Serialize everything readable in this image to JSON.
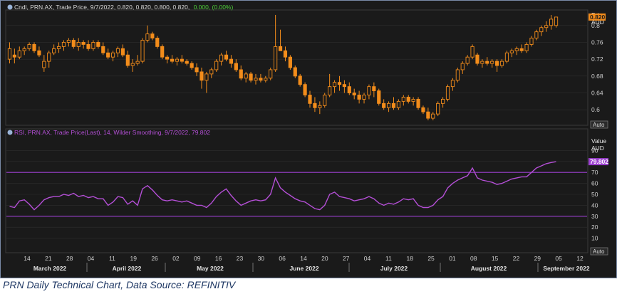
{
  "caption": "PRN Daily Technical Chart, Data Source: REFINITIV",
  "colors": {
    "background": "#1a1a1a",
    "candle": "#f28c1b",
    "rsi_line": "#b44fd6",
    "rsi_band": "#9c3fd0",
    "grid": "#2e2e2e",
    "axis_text": "#cfcfcf",
    "price_header_text": "#d8d8d8",
    "change_text": "#4fd13a"
  },
  "price_panel": {
    "header_parts": {
      "name": "Cndl, PRN.AX, Trade Price, 9/7/2022, 0.820, 0.820, 0.800, 0.820,",
      "change": "0.000, (0.00%)"
    },
    "axis_title": "Price",
    "axis_unit": "AUD",
    "last_value_tag": "0.820",
    "scale_button": "Auto",
    "ticks": [
      "0.8",
      "0.76",
      "0.72",
      "0.68",
      "0.64",
      "0.6"
    ]
  },
  "rsi_panel": {
    "header": "RSI, PRN.AX, Trade Price(Last), 14, Wilder Smoothing, 9/7/2022, 79.802",
    "axis_title": "Value",
    "axis_unit": "AUD",
    "last_value_tag": "79.802",
    "scale_button": "Auto",
    "ticks": [
      "90",
      "80",
      "70",
      "60",
      "50",
      "40",
      "30",
      "20",
      "10"
    ]
  },
  "x_axis": {
    "day_labels": [
      "14",
      "21",
      "28",
      "04",
      "11",
      "19",
      "26",
      "02",
      "09",
      "16",
      "23",
      "30",
      "06",
      "14",
      "20",
      "27",
      "04",
      "11",
      "18",
      "25",
      "01",
      "08",
      "15",
      "22",
      "29",
      "05",
      "12"
    ],
    "month_labels": [
      "March 2022",
      "April 2022",
      "May 2022",
      "June 2022",
      "July 2022",
      "August 2022",
      "September 2022"
    ]
  },
  "chart_data": [
    {
      "type": "candlestick",
      "ylabel": "Price AUD",
      "ylim": [
        0.57,
        0.83
      ],
      "ohlc": [
        [
          0.72,
          0.76,
          0.71,
          0.745
        ],
        [
          0.73,
          0.745,
          0.71,
          0.725
        ],
        [
          0.725,
          0.75,
          0.72,
          0.74
        ],
        [
          0.74,
          0.75,
          0.73,
          0.745
        ],
        [
          0.745,
          0.76,
          0.74,
          0.755
        ],
        [
          0.755,
          0.76,
          0.735,
          0.74
        ],
        [
          0.74,
          0.75,
          0.725,
          0.73
        ],
        [
          0.7,
          0.73,
          0.69,
          0.715
        ],
        [
          0.715,
          0.74,
          0.7,
          0.735
        ],
        [
          0.735,
          0.755,
          0.73,
          0.745
        ],
        [
          0.745,
          0.76,
          0.735,
          0.75
        ],
        [
          0.75,
          0.765,
          0.74,
          0.76
        ],
        [
          0.76,
          0.77,
          0.75,
          0.765
        ],
        [
          0.765,
          0.77,
          0.745,
          0.75
        ],
        [
          0.75,
          0.77,
          0.74,
          0.76
        ],
        [
          0.76,
          0.765,
          0.745,
          0.755
        ],
        [
          0.755,
          0.765,
          0.74,
          0.745
        ],
        [
          0.745,
          0.765,
          0.74,
          0.76
        ],
        [
          0.76,
          0.765,
          0.745,
          0.75
        ],
        [
          0.75,
          0.76,
          0.73,
          0.735
        ],
        [
          0.735,
          0.745,
          0.72,
          0.725
        ],
        [
          0.725,
          0.74,
          0.715,
          0.735
        ],
        [
          0.735,
          0.75,
          0.725,
          0.745
        ],
        [
          0.745,
          0.755,
          0.725,
          0.73
        ],
        [
          0.73,
          0.74,
          0.7,
          0.705
        ],
        [
          0.705,
          0.72,
          0.69,
          0.71
        ],
        [
          0.71,
          0.73,
          0.705,
          0.715
        ],
        [
          0.715,
          0.77,
          0.71,
          0.765
        ],
        [
          0.765,
          0.8,
          0.76,
          0.78
        ],
        [
          0.78,
          0.785,
          0.765,
          0.77
        ],
        [
          0.77,
          0.775,
          0.745,
          0.75
        ],
        [
          0.75,
          0.755,
          0.72,
          0.725
        ],
        [
          0.725,
          0.73,
          0.71,
          0.72
        ],
        [
          0.72,
          0.73,
          0.71,
          0.715
        ],
        [
          0.715,
          0.725,
          0.705,
          0.72
        ],
        [
          0.72,
          0.73,
          0.71,
          0.715
        ],
        [
          0.715,
          0.72,
          0.705,
          0.71
        ],
        [
          0.71,
          0.715,
          0.695,
          0.7
        ],
        [
          0.7,
          0.71,
          0.68,
          0.69
        ],
        [
          0.69,
          0.7,
          0.65,
          0.67
        ],
        [
          0.67,
          0.69,
          0.64,
          0.685
        ],
        [
          0.685,
          0.7,
          0.675,
          0.695
        ],
        [
          0.695,
          0.72,
          0.69,
          0.715
        ],
        [
          0.715,
          0.735,
          0.705,
          0.73
        ],
        [
          0.73,
          0.74,
          0.715,
          0.72
        ],
        [
          0.72,
          0.73,
          0.7,
          0.71
        ],
        [
          0.71,
          0.72,
          0.69,
          0.695
        ],
        [
          0.695,
          0.705,
          0.67,
          0.675
        ],
        [
          0.675,
          0.69,
          0.665,
          0.685
        ],
        [
          0.685,
          0.69,
          0.665,
          0.67
        ],
        [
          0.67,
          0.685,
          0.66,
          0.675
        ],
        [
          0.675,
          0.685,
          0.665,
          0.67
        ],
        [
          0.67,
          0.68,
          0.665,
          0.675
        ],
        [
          0.675,
          0.7,
          0.67,
          0.695
        ],
        [
          0.695,
          0.825,
          0.69,
          0.75
        ],
        [
          0.75,
          0.79,
          0.74,
          0.74
        ],
        [
          0.74,
          0.75,
          0.715,
          0.725
        ],
        [
          0.725,
          0.73,
          0.695,
          0.7
        ],
        [
          0.7,
          0.705,
          0.675,
          0.68
        ],
        [
          0.68,
          0.685,
          0.655,
          0.66
        ],
        [
          0.66,
          0.665,
          0.63,
          0.635
        ],
        [
          0.635,
          0.645,
          0.605,
          0.615
        ],
        [
          0.615,
          0.63,
          0.595,
          0.605
        ],
        [
          0.605,
          0.62,
          0.59,
          0.61
        ],
        [
          0.61,
          0.64,
          0.605,
          0.635
        ],
        [
          0.635,
          0.685,
          0.63,
          0.655
        ],
        [
          0.655,
          0.67,
          0.64,
          0.665
        ],
        [
          0.665,
          0.68,
          0.645,
          0.66
        ],
        [
          0.66,
          0.67,
          0.64,
          0.655
        ],
        [
          0.655,
          0.665,
          0.635,
          0.64
        ],
        [
          0.64,
          0.65,
          0.625,
          0.635
        ],
        [
          0.635,
          0.645,
          0.615,
          0.625
        ],
        [
          0.625,
          0.64,
          0.615,
          0.635
        ],
        [
          0.635,
          0.66,
          0.625,
          0.655
        ],
        [
          0.655,
          0.665,
          0.63,
          0.645
        ],
        [
          0.645,
          0.65,
          0.61,
          0.615
        ],
        [
          0.615,
          0.625,
          0.6,
          0.605
        ],
        [
          0.605,
          0.62,
          0.595,
          0.615
        ],
        [
          0.615,
          0.63,
          0.6,
          0.605
        ],
        [
          0.605,
          0.625,
          0.6,
          0.62
        ],
        [
          0.62,
          0.635,
          0.61,
          0.63
        ],
        [
          0.63,
          0.635,
          0.615,
          0.62
        ],
        [
          0.62,
          0.63,
          0.61,
          0.625
        ],
        [
          0.625,
          0.63,
          0.6,
          0.605
        ],
        [
          0.605,
          0.61,
          0.59,
          0.595
        ],
        [
          0.595,
          0.605,
          0.575,
          0.58
        ],
        [
          0.58,
          0.595,
          0.575,
          0.59
        ],
        [
          0.59,
          0.62,
          0.585,
          0.615
        ],
        [
          0.615,
          0.63,
          0.605,
          0.625
        ],
        [
          0.625,
          0.66,
          0.62,
          0.655
        ],
        [
          0.655,
          0.675,
          0.645,
          0.67
        ],
        [
          0.67,
          0.7,
          0.665,
          0.695
        ],
        [
          0.695,
          0.715,
          0.685,
          0.71
        ],
        [
          0.71,
          0.73,
          0.705,
          0.725
        ],
        [
          0.725,
          0.755,
          0.72,
          0.75
        ],
        [
          0.73,
          0.735,
          0.705,
          0.71
        ],
        [
          0.71,
          0.72,
          0.7,
          0.715
        ],
        [
          0.715,
          0.725,
          0.705,
          0.71
        ],
        [
          0.71,
          0.72,
          0.7,
          0.715
        ],
        [
          0.715,
          0.72,
          0.69,
          0.705
        ],
        [
          0.705,
          0.72,
          0.7,
          0.715
        ],
        [
          0.715,
          0.74,
          0.71,
          0.735
        ],
        [
          0.735,
          0.745,
          0.725,
          0.74
        ],
        [
          0.74,
          0.75,
          0.73,
          0.745
        ],
        [
          0.745,
          0.755,
          0.735,
          0.74
        ],
        [
          0.74,
          0.76,
          0.735,
          0.755
        ],
        [
          0.755,
          0.775,
          0.75,
          0.77
        ],
        [
          0.77,
          0.79,
          0.765,
          0.785
        ],
        [
          0.785,
          0.8,
          0.775,
          0.795
        ],
        [
          0.795,
          0.81,
          0.785,
          0.8
        ],
        [
          0.8,
          0.825,
          0.79,
          0.815
        ],
        [
          0.8,
          0.82,
          0.795,
          0.82
        ]
      ]
    },
    {
      "type": "line",
      "name": "RSI",
      "ylabel": "Value AUD",
      "ylim": [
        0,
        100
      ],
      "bands": [
        70,
        30
      ],
      "values": [
        39,
        38,
        44,
        45,
        41,
        36,
        40,
        45,
        47,
        48,
        48,
        50,
        49,
        51,
        48,
        49,
        47,
        48,
        46,
        46,
        40,
        43,
        48,
        47,
        41,
        44,
        40,
        55,
        58,
        54,
        49,
        45,
        44,
        45,
        44,
        43,
        44,
        42,
        40,
        40,
        38,
        42,
        48,
        52,
        55,
        49,
        44,
        40,
        42,
        44,
        45,
        44,
        45,
        50,
        65,
        56,
        52,
        49,
        46,
        44,
        43,
        40,
        37,
        36,
        40,
        50,
        52,
        48,
        47,
        46,
        44,
        45,
        46,
        48,
        46,
        42,
        40,
        42,
        41,
        43,
        46,
        45,
        46,
        40,
        38,
        38,
        40,
        45,
        48,
        56,
        60,
        63,
        65,
        67,
        74,
        65,
        63,
        62,
        61,
        59,
        60,
        62,
        64,
        65,
        66,
        66,
        70,
        74,
        76,
        78,
        79,
        79.8
      ]
    }
  ]
}
